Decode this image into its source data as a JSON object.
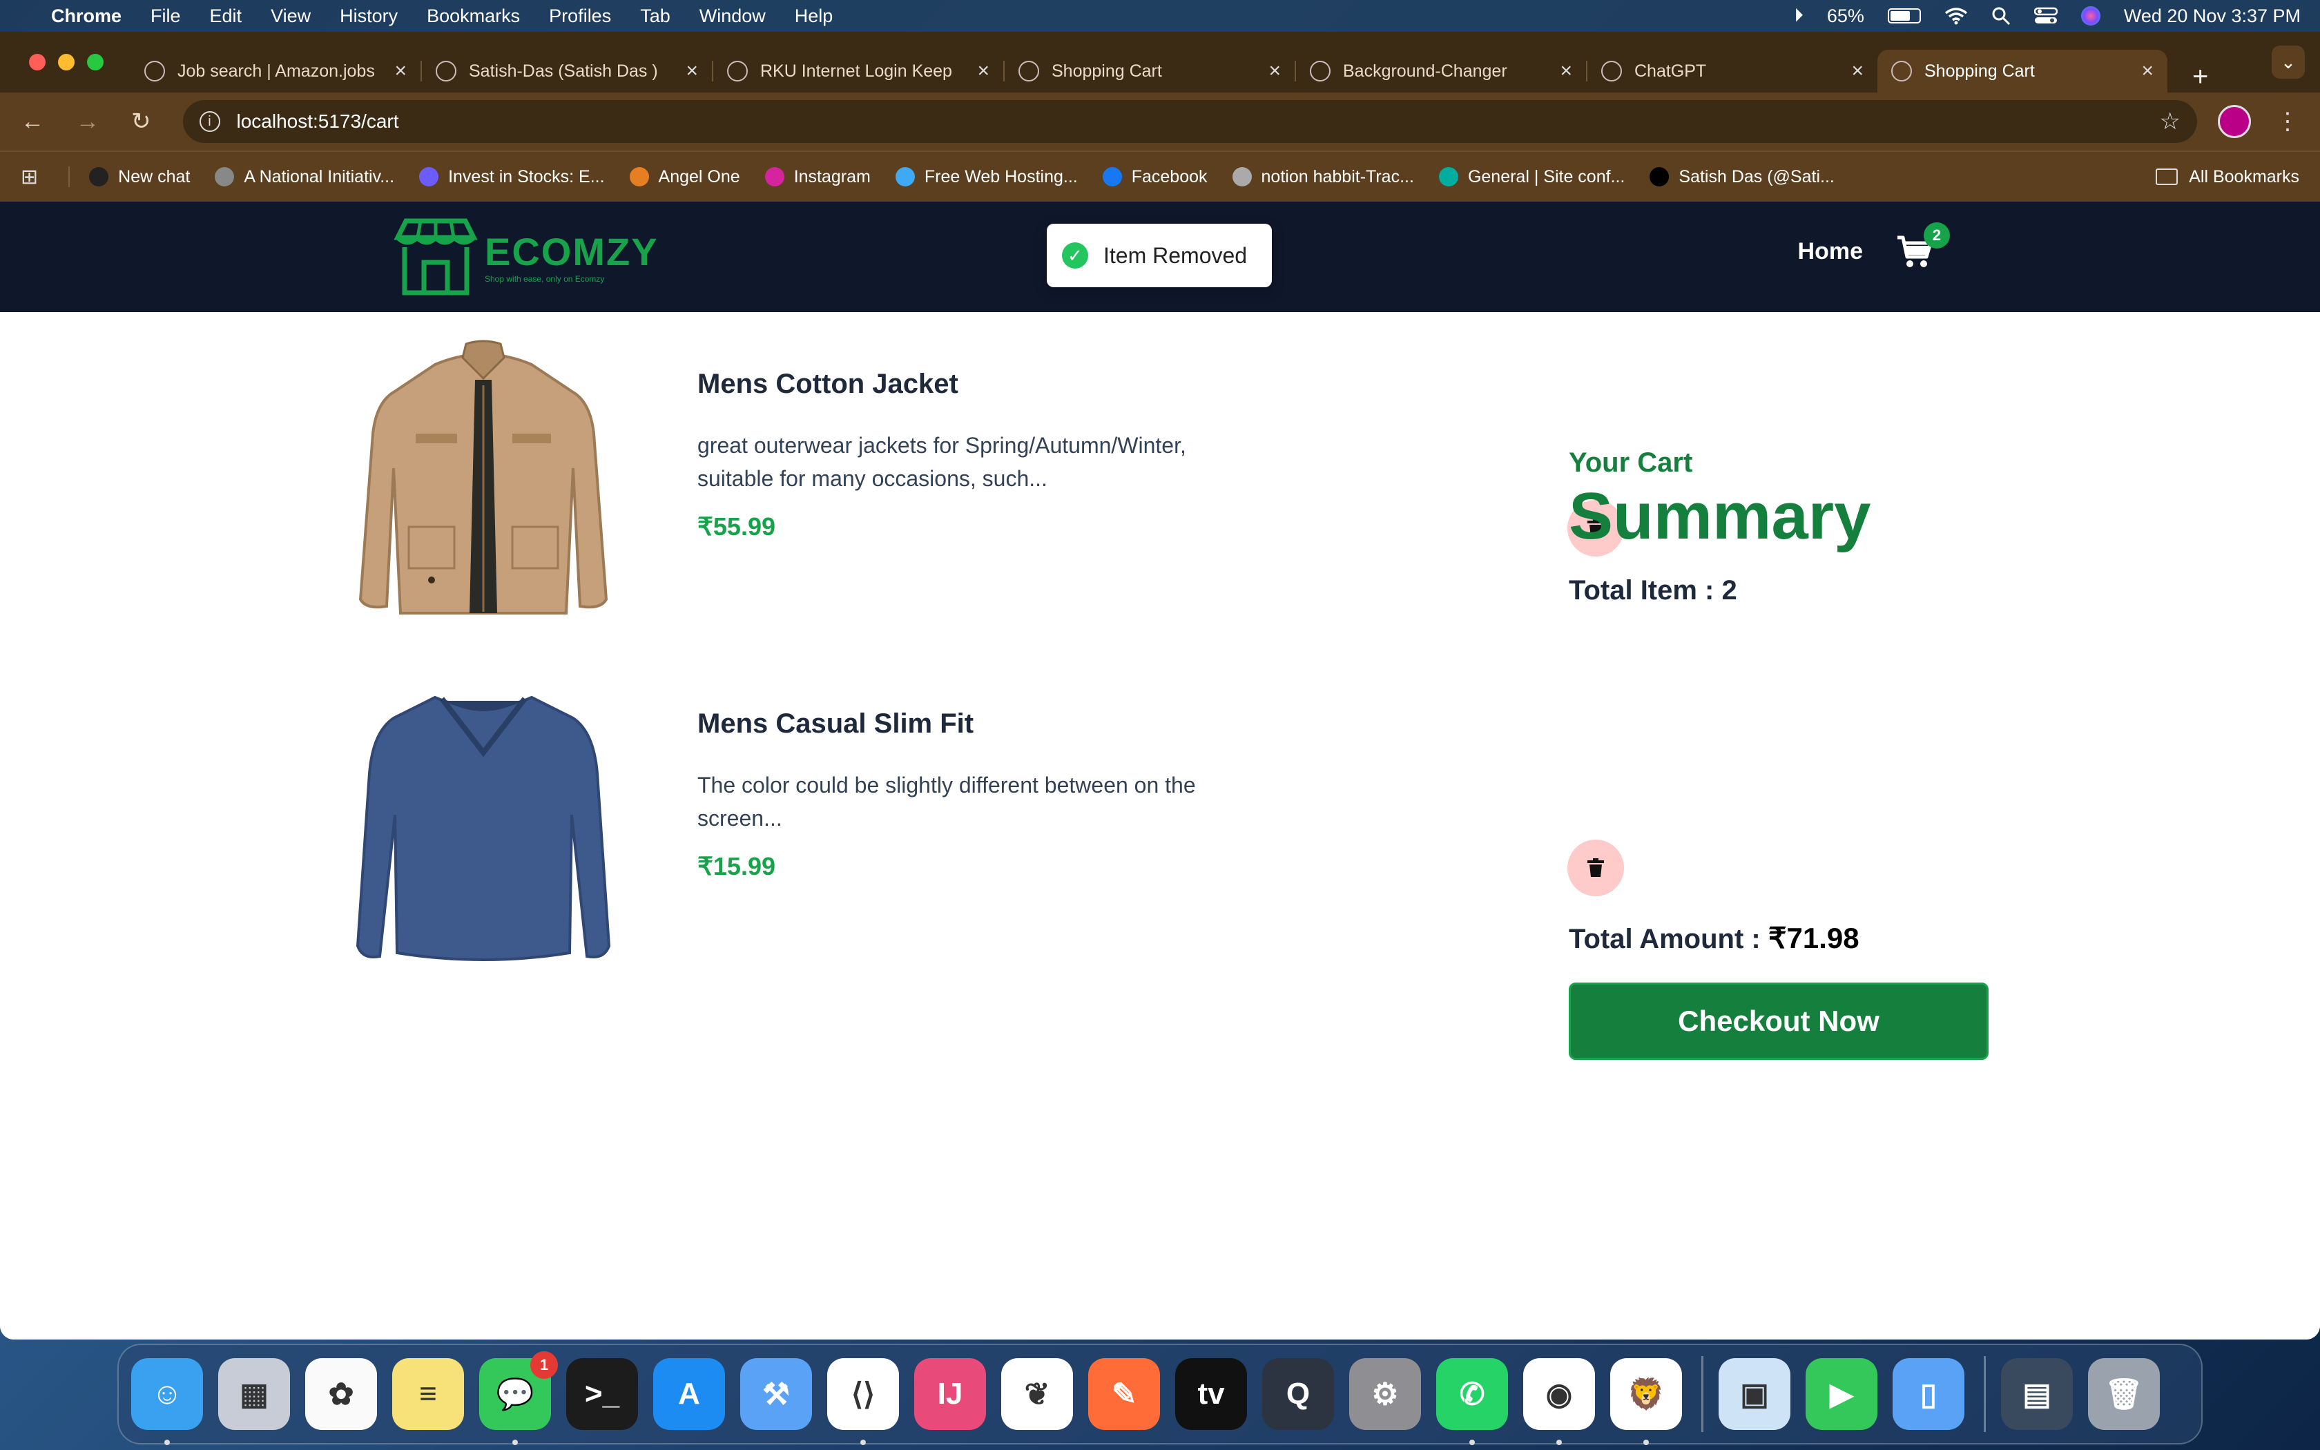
{
  "menubar": {
    "app_name": "Chrome",
    "items": [
      "File",
      "Edit",
      "View",
      "History",
      "Bookmarks",
      "Profiles",
      "Tab",
      "Window",
      "Help"
    ],
    "battery": "65%",
    "datetime": "Wed 20 Nov  3:37 PM"
  },
  "tabs": [
    {
      "title": "Job search | Amazon.jobs",
      "icon": "amazon-icon",
      "active": false
    },
    {
      "title": "Satish-Das (Satish Das )",
      "icon": "github-icon",
      "active": false
    },
    {
      "title": "RKU Internet Login Keep",
      "icon": "globe-icon",
      "active": false
    },
    {
      "title": "Shopping Cart",
      "icon": "globe-icon",
      "active": false
    },
    {
      "title": "Background-Changer",
      "icon": "globe-icon",
      "active": false
    },
    {
      "title": "ChatGPT",
      "icon": "chatgpt-icon",
      "active": false
    },
    {
      "title": "Shopping Cart",
      "icon": "globe-icon",
      "active": true
    }
  ],
  "omnibox": {
    "url": "localhost:5173/cart"
  },
  "bookmarks": {
    "items": [
      {
        "label": "New chat",
        "color": "#222"
      },
      {
        "label": "A National Initiativ...",
        "color": "#888"
      },
      {
        "label": "Invest in Stocks: E...",
        "color": "#6a5cff"
      },
      {
        "label": "Angel One",
        "color": "#e67e22"
      },
      {
        "label": "Instagram",
        "color": "#d6249f"
      },
      {
        "label": "Free Web Hosting...",
        "color": "#3fa9f5"
      },
      {
        "label": "Facebook",
        "color": "#1877f2"
      },
      {
        "label": "notion habbit-Trac...",
        "color": "#aaa"
      },
      {
        "label": "General | Site conf...",
        "color": "#00ad9f"
      },
      {
        "label": "Satish Das (@Sati...",
        "color": "#000"
      }
    ],
    "all_label": "All Bookmarks"
  },
  "site": {
    "brand": "ECOMZY",
    "tagline": "Shop with ease, only on Ecomzy",
    "nav_home": "Home",
    "cart_count": "2",
    "toast": "Item Removed"
  },
  "cart": {
    "items": [
      {
        "name": "Mens Cotton Jacket",
        "description": "great outerwear jackets for Spring/Autumn/Winter, suitable for many occasions, such...",
        "price": "₹55.99"
      },
      {
        "name": "Mens Casual Slim Fit",
        "description": "The color could be slightly different between on the screen...",
        "price": "₹15.99"
      }
    ]
  },
  "summary": {
    "your_cart": "Your Cart",
    "title": "Summary",
    "total_items_label": "Total Item : 2",
    "total_amount_label": "Total Amount : ",
    "total_amount_value": "₹71.98",
    "checkout_label": "Checkout Now"
  },
  "dock": {
    "apps": [
      {
        "name": "finder",
        "color": "#3aa0f0",
        "glyph": "☺",
        "running": true
      },
      {
        "name": "launchpad",
        "color": "#c7ccd6",
        "glyph": "▦",
        "running": false
      },
      {
        "name": "photos",
        "color": "#fafafa",
        "glyph": "✿",
        "running": false
      },
      {
        "name": "notes",
        "color": "#f7e27a",
        "glyph": "≡",
        "running": false
      },
      {
        "name": "messages",
        "color": "#34c759",
        "glyph": "💬",
        "running": true,
        "badge": "1"
      },
      {
        "name": "terminal",
        "color": "#1c1c1c",
        "glyph": ">_",
        "running": false
      },
      {
        "name": "app-store",
        "color": "#1c8cf2",
        "glyph": "A",
        "running": false
      },
      {
        "name": "xcode",
        "color": "#5aa2f5",
        "glyph": "⚒",
        "running": false
      },
      {
        "name": "vscode",
        "color": "#ffffff",
        "glyph": "⟨⟩",
        "running": true
      },
      {
        "name": "intellij",
        "color": "#e84a7a",
        "glyph": "IJ",
        "running": false
      },
      {
        "name": "mongodb",
        "color": "#ffffff",
        "glyph": "❦",
        "running": false
      },
      {
        "name": "postman",
        "color": "#ff6c37",
        "glyph": "✎",
        "running": false
      },
      {
        "name": "apple-tv",
        "color": "#111111",
        "glyph": "tv",
        "running": false
      },
      {
        "name": "quicktime",
        "color": "#2b3440",
        "glyph": "Q",
        "running": false
      },
      {
        "name": "system-settings",
        "color": "#8e8e93",
        "glyph": "⚙",
        "running": false
      },
      {
        "name": "whatsapp",
        "color": "#25d366",
        "glyph": "✆",
        "running": true
      },
      {
        "name": "chrome",
        "color": "#ffffff",
        "glyph": "◉",
        "running": true
      },
      {
        "name": "brave",
        "color": "#ffffff",
        "glyph": "🦁",
        "running": true
      },
      {
        "name": "preview",
        "color": "#cfe3f7",
        "glyph": "▣",
        "running": false
      },
      {
        "name": "facetime",
        "color": "#34c759",
        "glyph": "▶",
        "running": false
      },
      {
        "name": "simulator",
        "color": "#5aa2f5",
        "glyph": "▯",
        "running": false
      },
      {
        "name": "downloads-stack",
        "color": "#3a4a5e",
        "glyph": "▤",
        "running": false
      },
      {
        "name": "trash",
        "color": "#9aa3ad",
        "glyph": "🗑",
        "running": false
      }
    ]
  }
}
